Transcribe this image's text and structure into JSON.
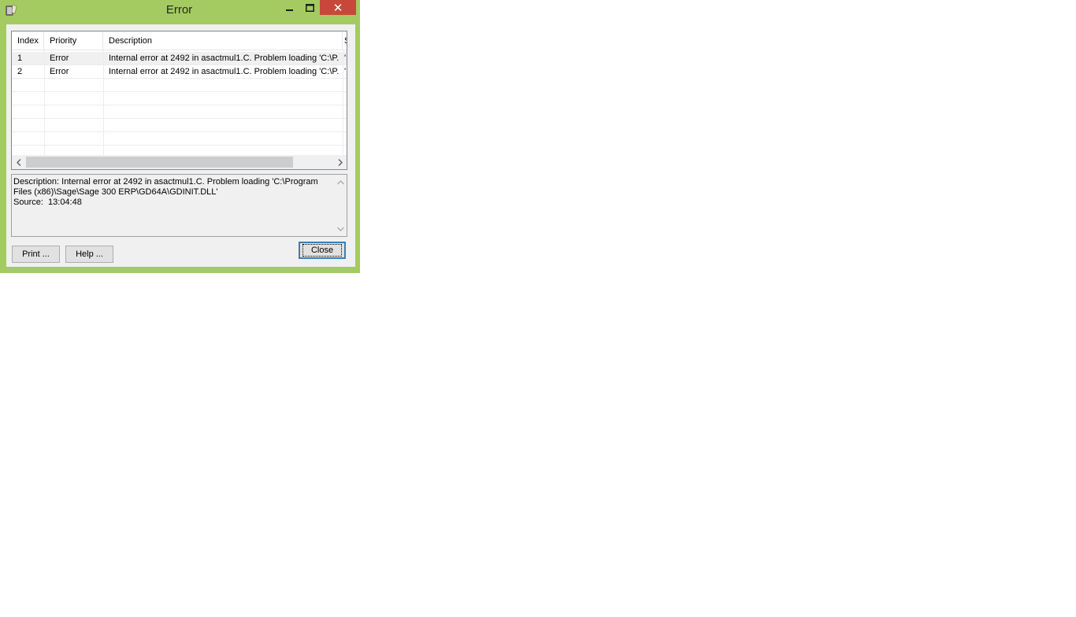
{
  "window": {
    "title": "Error",
    "colors": {
      "frame": "#a3cb62",
      "close_button": "#c7483a"
    }
  },
  "title_buttons": {
    "minimize": "–",
    "maximize": "☐",
    "close": "✕"
  },
  "list": {
    "columns": [
      "Index",
      "Priority",
      "Description",
      "S"
    ],
    "rows": [
      {
        "index": "1",
        "priority": "Error",
        "description": "Internal error at 2492 in asactmul1.C. Problem loading 'C:\\P...",
        "extra": "'"
      },
      {
        "index": "2",
        "priority": "Error",
        "description": "Internal error at 2492 in asactmul1.C. Problem loading 'C:\\P...",
        "extra": "'"
      }
    ]
  },
  "detail": {
    "text": "Description: Internal error at 2492 in asactmul1.C. Problem loading 'C:\\Program Files (x86)\\Sage\\Sage 300 ERP\\GD64A\\GDINIT.DLL'\nSource:  13:04:48"
  },
  "buttons": {
    "print_label": "Print ...",
    "help_label": "Help ...",
    "close_label": "Close"
  }
}
